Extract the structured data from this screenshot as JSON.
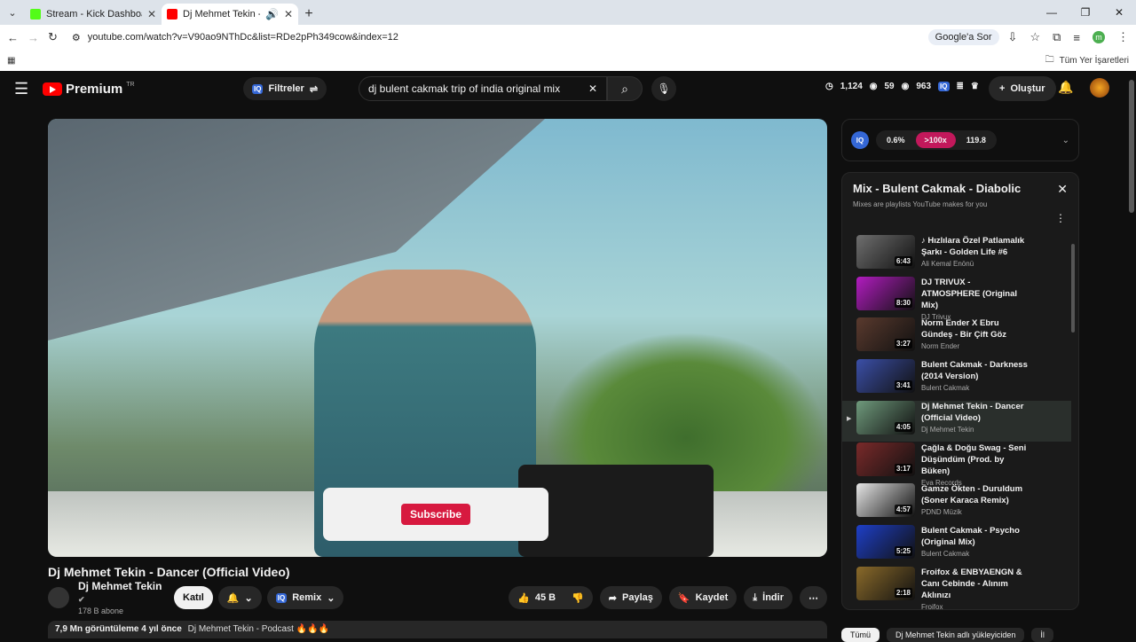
{
  "browser": {
    "tabs": [
      {
        "title": "Stream - Kick Dashboard",
        "favicon_color": "#53fc18"
      },
      {
        "title": "Dj Mehmet Tekin - Dancer",
        "favicon_color": "#ff0000"
      }
    ],
    "url": "youtube.com/watch?v=V90ao9NThDc&list=RDe2pPh349cow&index=12",
    "google_btn": "Google'a Sor",
    "profile_initial": "m",
    "bookmarks_all": "Tüm Yer İşaretleri"
  },
  "header": {
    "logo_text": "Premium",
    "logo_region": "TR",
    "filters_label": "Filtreler",
    "search_query": "dj bulent cakmak trip of india original mix",
    "stats": [
      "1,124",
      "59",
      "963"
    ],
    "create_label": "Oluştur"
  },
  "video": {
    "overlay_button": "Subscribe",
    "title": "Dj Mehmet Tekin - Dancer (Official Video)",
    "channel": "Dj Mehmet Tekin",
    "subscribers": "178 B abone",
    "join_label": "Katıl",
    "remix_label": "Remix",
    "likes": "45 B",
    "share_label": "Paylaş",
    "save_label": "Kaydet",
    "download_label": "İndir",
    "desc_views": "7,9 Mn görüntüleme  4 yıl önce",
    "desc_text": "Dj Mehmet Tekin - Podcast 🔥🔥🔥"
  },
  "iq": {
    "logo": "IQ",
    "values": [
      "0.6%",
      ">100x",
      "119.8"
    ]
  },
  "playlist": {
    "title": "Mix - Bulent Cakmak - Diabolic",
    "subtitle": "Mixes are playlists YouTube makes for you",
    "items": [
      {
        "title": "♪ Hızlılara Özel Patlamalık Şarkı - Golden Life #6",
        "channel": "Ali Kemal Enönü",
        "duration": "6:43",
        "color": "#6f6f6f"
      },
      {
        "title": "DJ TRIVUX - ATMOSPHERE (Original Mix)",
        "channel": "DJ Trivux",
        "duration": "8:30",
        "color": "#b21cc0"
      },
      {
        "title": "Norm Ender X Ebru Gündeş - Bir Çift Göz",
        "channel": "Norm Ender",
        "duration": "3:27",
        "color": "#5a3a2e"
      },
      {
        "title": "Bulent Cakmak - Darkness (2014 Version)",
        "channel": "Bulent Cakmak",
        "duration": "3:41",
        "color": "#3b4fa8"
      },
      {
        "title": "Dj Mehmet Tekin - Dancer (Official Video)",
        "channel": "Dj Mehmet Tekin",
        "duration": "4:05",
        "color": "#6f9a7c"
      },
      {
        "title": "Çağla & Doğu Swag - Seni Düşündüm (Prod. by Büken)",
        "channel": "Eva Records",
        "duration": "3:17",
        "color": "#7a2a2a"
      },
      {
        "title": "Gamze Ökten - Duruldum (Soner Karaca Remix)",
        "channel": "PDND Müzik",
        "duration": "4:57",
        "color": "#e6e6e6"
      },
      {
        "title": "Bulent Cakmak - Psycho (Original Mix)",
        "channel": "Bulent Cakmak",
        "duration": "5:25",
        "color": "#1e3fc8"
      },
      {
        "title": "Froifox & ENBYAENGN & Canı Cebinde - Alınım Aklınızı",
        "channel": "Froifox",
        "duration": "2:18",
        "color": "#8a6a2a"
      }
    ]
  },
  "chips": [
    "Tümü",
    "Dj Mehmet Tekin adlı yükleyiciden",
    "İl"
  ]
}
